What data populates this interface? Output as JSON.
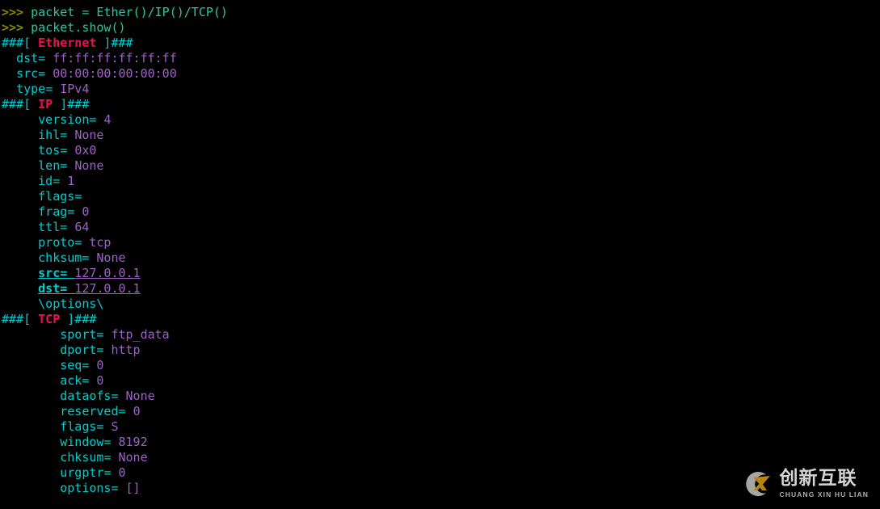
{
  "terminal": {
    "background": "#000000",
    "colors": {
      "prompt": "#8a8a00",
      "code": "#28c8a0",
      "hash": "#00cdcd",
      "layer_name": "#f01050",
      "field_name": "#00cdcd",
      "field_value": "#a060c8"
    },
    "lines": [
      {
        "kind": "input",
        "prompt": ">>> ",
        "code": "packet = Ether()/IP()/TCP()"
      },
      {
        "kind": "input",
        "prompt": ">>> ",
        "code": "packet.show()"
      },
      {
        "kind": "header",
        "open": "###[ ",
        "layer": "Ethernet",
        "close": " ]###"
      },
      {
        "kind": "field",
        "indent": "  ",
        "name": "dst",
        "eq": "= ",
        "value": "ff:ff:ff:ff:ff:ff"
      },
      {
        "kind": "field",
        "indent": "  ",
        "name": "src",
        "eq": "= ",
        "value": "00:00:00:00:00:00"
      },
      {
        "kind": "field",
        "indent": "  ",
        "name": "type",
        "eq": "= ",
        "value": "IPv4"
      },
      {
        "kind": "header",
        "open": "###[ ",
        "layer": "IP",
        "close": " ]###"
      },
      {
        "kind": "field",
        "indent": "     ",
        "name": "version",
        "eq": "= ",
        "value": "4"
      },
      {
        "kind": "field",
        "indent": "     ",
        "name": "ihl",
        "eq": "= ",
        "value": "None"
      },
      {
        "kind": "field",
        "indent": "     ",
        "name": "tos",
        "eq": "= ",
        "value": "0x0"
      },
      {
        "kind": "field",
        "indent": "     ",
        "name": "len",
        "eq": "= ",
        "value": "None"
      },
      {
        "kind": "field",
        "indent": "     ",
        "name": "id",
        "eq": "= ",
        "value": "1"
      },
      {
        "kind": "field",
        "indent": "     ",
        "name": "flags",
        "eq": "= ",
        "value": ""
      },
      {
        "kind": "field",
        "indent": "     ",
        "name": "frag",
        "eq": "= ",
        "value": "0"
      },
      {
        "kind": "field",
        "indent": "     ",
        "name": "ttl",
        "eq": "= ",
        "value": "64"
      },
      {
        "kind": "field",
        "indent": "     ",
        "name": "proto",
        "eq": "= ",
        "value": "tcp"
      },
      {
        "kind": "field",
        "indent": "     ",
        "name": "chksum",
        "eq": "= ",
        "value": "None"
      },
      {
        "kind": "field_underline",
        "indent": "     ",
        "name": "src",
        "eq": "= ",
        "value": "127.0.0.1"
      },
      {
        "kind": "field_underline",
        "indent": "     ",
        "name": "dst",
        "eq": "= ",
        "value": "127.0.0.1"
      },
      {
        "kind": "options",
        "indent": "     ",
        "text": "\\options\\"
      },
      {
        "kind": "header",
        "open": "###[ ",
        "layer": "TCP",
        "close": " ]###"
      },
      {
        "kind": "field",
        "indent": "        ",
        "name": "sport",
        "eq": "= ",
        "value": "ftp_data"
      },
      {
        "kind": "field",
        "indent": "        ",
        "name": "dport",
        "eq": "= ",
        "value": "http"
      },
      {
        "kind": "field",
        "indent": "        ",
        "name": "seq",
        "eq": "= ",
        "value": "0"
      },
      {
        "kind": "field",
        "indent": "        ",
        "name": "ack",
        "eq": "= ",
        "value": "0"
      },
      {
        "kind": "field",
        "indent": "        ",
        "name": "dataofs",
        "eq": "= ",
        "value": "None"
      },
      {
        "kind": "field",
        "indent": "        ",
        "name": "reserved",
        "eq": "= ",
        "value": "0"
      },
      {
        "kind": "field",
        "indent": "        ",
        "name": "flags",
        "eq": "= ",
        "value": "S"
      },
      {
        "kind": "field",
        "indent": "        ",
        "name": "window",
        "eq": "= ",
        "value": "8192"
      },
      {
        "kind": "field",
        "indent": "        ",
        "name": "chksum",
        "eq": "= ",
        "value": "None"
      },
      {
        "kind": "field",
        "indent": "        ",
        "name": "urgptr",
        "eq": "= ",
        "value": "0"
      },
      {
        "kind": "field",
        "indent": "        ",
        "name": "options",
        "eq": "= ",
        "value": "[]"
      }
    ]
  },
  "watermark": {
    "chinese": "创新互联",
    "pinyin": "CHUANG XIN HU LIAN",
    "mark_icon": "cx-logo-icon",
    "ring_color": "#b5b5b5",
    "swoosh_color": "#c8920f"
  }
}
